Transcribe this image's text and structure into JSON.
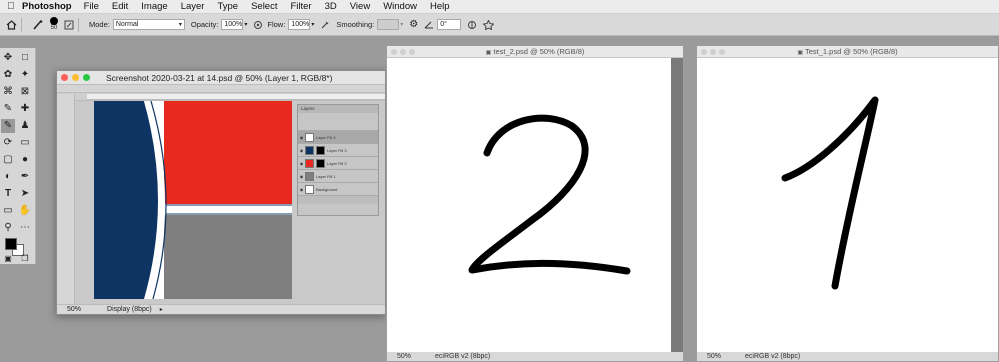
{
  "menubar": {
    "app_name": "Photoshop",
    "items": [
      "File",
      "Edit",
      "Image",
      "Layer",
      "Type",
      "Select",
      "Filter",
      "3D",
      "View",
      "Window",
      "Help"
    ]
  },
  "options_bar": {
    "brush_size": "50",
    "mode_label": "Mode:",
    "mode_value": "Normal",
    "opacity_label": "Opacity:",
    "opacity_value": "100%",
    "flow_label": "Flow:",
    "flow_value": "100%",
    "smoothing_label": "Smoothing:",
    "angle_value": "0°"
  },
  "window_screenshot": {
    "title": "Screenshot 2020-03-21 at 14.psd @ 50% (Layer 1, RGB/8*)",
    "zoom": "50%",
    "status": "Display (8bpc)",
    "layers_panel_title": "Layers",
    "layers": [
      {
        "name": "Layer Fill 4",
        "selected": true
      },
      {
        "name": "Layer Fill 3",
        "selected": false
      },
      {
        "name": "Layer Fill 2",
        "selected": false
      },
      {
        "name": "Layer Fill 1",
        "selected": false
      },
      {
        "name": "Background",
        "selected": false
      }
    ]
  },
  "window_test2": {
    "title": "test_2.psd @ 50% (RGB/8)",
    "zoom": "50%",
    "status": "eciRGB v2 (8bpc)"
  },
  "window_test1": {
    "title": "Test_1.psd @ 50% (RGB/8)",
    "zoom": "50%",
    "status": "eciRGB v2 (8bpc)"
  },
  "colors": {
    "navy": "#0d3463",
    "red": "#e8291f",
    "gray": "#7f7f7f",
    "foreground": "#000000",
    "background": "#ffffff"
  }
}
